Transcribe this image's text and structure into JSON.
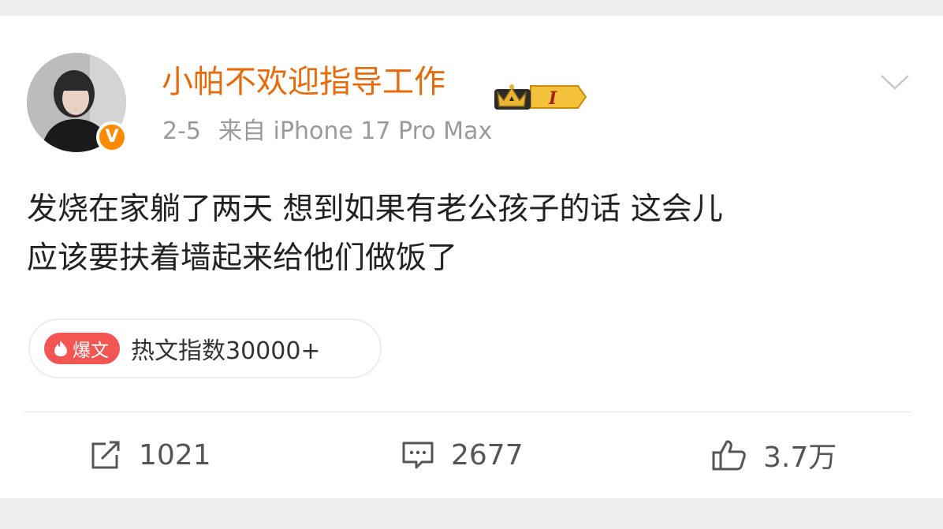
{
  "post": {
    "username": "小帕不欢迎指导工作",
    "level_badge": "I",
    "date": "2-5",
    "source": "来自 iPhone 17 Pro Max",
    "content_lines": [
      "发烧在家躺了两天 想到如果有老公孩子的话 这会儿",
      "应该要扶着墙起来给他们做饭了"
    ],
    "verified_badge": "V",
    "hot": {
      "tag": "爆文",
      "text": "热文指数30000+"
    }
  },
  "actions": {
    "reposts": "1021",
    "comments": "2677",
    "likes": "3.7万"
  },
  "icons": {
    "verified": "verified-badge-icon",
    "crown": "crown-level-icon",
    "more": "chevron-down-icon",
    "hot": "flame-icon",
    "repost": "repost-icon",
    "comment": "comment-icon",
    "like": "thumbs-up-icon"
  },
  "colors": {
    "username": "#e86b0b",
    "verified": "#ff8a00",
    "hot_tag": "#f25552",
    "meta": "#9a9a9a"
  }
}
